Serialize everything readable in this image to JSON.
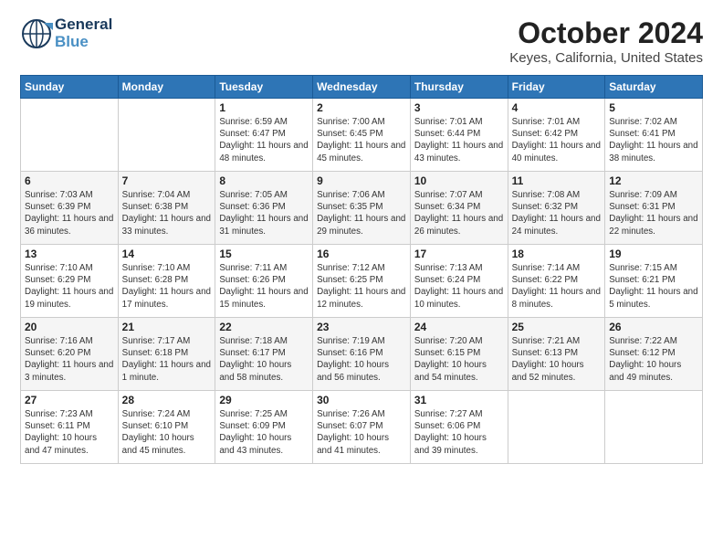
{
  "header": {
    "logo_general": "General",
    "logo_blue": "Blue",
    "title": "October 2024",
    "subtitle": "Keyes, California, United States"
  },
  "days_of_week": [
    "Sunday",
    "Monday",
    "Tuesday",
    "Wednesday",
    "Thursday",
    "Friday",
    "Saturday"
  ],
  "weeks": [
    [
      {
        "day": "",
        "info": ""
      },
      {
        "day": "",
        "info": ""
      },
      {
        "day": "1",
        "info": "Sunrise: 6:59 AM\nSunset: 6:47 PM\nDaylight: 11 hours and 48 minutes."
      },
      {
        "day": "2",
        "info": "Sunrise: 7:00 AM\nSunset: 6:45 PM\nDaylight: 11 hours and 45 minutes."
      },
      {
        "day": "3",
        "info": "Sunrise: 7:01 AM\nSunset: 6:44 PM\nDaylight: 11 hours and 43 minutes."
      },
      {
        "day": "4",
        "info": "Sunrise: 7:01 AM\nSunset: 6:42 PM\nDaylight: 11 hours and 40 minutes."
      },
      {
        "day": "5",
        "info": "Sunrise: 7:02 AM\nSunset: 6:41 PM\nDaylight: 11 hours and 38 minutes."
      }
    ],
    [
      {
        "day": "6",
        "info": "Sunrise: 7:03 AM\nSunset: 6:39 PM\nDaylight: 11 hours and 36 minutes."
      },
      {
        "day": "7",
        "info": "Sunrise: 7:04 AM\nSunset: 6:38 PM\nDaylight: 11 hours and 33 minutes."
      },
      {
        "day": "8",
        "info": "Sunrise: 7:05 AM\nSunset: 6:36 PM\nDaylight: 11 hours and 31 minutes."
      },
      {
        "day": "9",
        "info": "Sunrise: 7:06 AM\nSunset: 6:35 PM\nDaylight: 11 hours and 29 minutes."
      },
      {
        "day": "10",
        "info": "Sunrise: 7:07 AM\nSunset: 6:34 PM\nDaylight: 11 hours and 26 minutes."
      },
      {
        "day": "11",
        "info": "Sunrise: 7:08 AM\nSunset: 6:32 PM\nDaylight: 11 hours and 24 minutes."
      },
      {
        "day": "12",
        "info": "Sunrise: 7:09 AM\nSunset: 6:31 PM\nDaylight: 11 hours and 22 minutes."
      }
    ],
    [
      {
        "day": "13",
        "info": "Sunrise: 7:10 AM\nSunset: 6:29 PM\nDaylight: 11 hours and 19 minutes."
      },
      {
        "day": "14",
        "info": "Sunrise: 7:10 AM\nSunset: 6:28 PM\nDaylight: 11 hours and 17 minutes."
      },
      {
        "day": "15",
        "info": "Sunrise: 7:11 AM\nSunset: 6:26 PM\nDaylight: 11 hours and 15 minutes."
      },
      {
        "day": "16",
        "info": "Sunrise: 7:12 AM\nSunset: 6:25 PM\nDaylight: 11 hours and 12 minutes."
      },
      {
        "day": "17",
        "info": "Sunrise: 7:13 AM\nSunset: 6:24 PM\nDaylight: 11 hours and 10 minutes."
      },
      {
        "day": "18",
        "info": "Sunrise: 7:14 AM\nSunset: 6:22 PM\nDaylight: 11 hours and 8 minutes."
      },
      {
        "day": "19",
        "info": "Sunrise: 7:15 AM\nSunset: 6:21 PM\nDaylight: 11 hours and 5 minutes."
      }
    ],
    [
      {
        "day": "20",
        "info": "Sunrise: 7:16 AM\nSunset: 6:20 PM\nDaylight: 11 hours and 3 minutes."
      },
      {
        "day": "21",
        "info": "Sunrise: 7:17 AM\nSunset: 6:18 PM\nDaylight: 11 hours and 1 minute."
      },
      {
        "day": "22",
        "info": "Sunrise: 7:18 AM\nSunset: 6:17 PM\nDaylight: 10 hours and 58 minutes."
      },
      {
        "day": "23",
        "info": "Sunrise: 7:19 AM\nSunset: 6:16 PM\nDaylight: 10 hours and 56 minutes."
      },
      {
        "day": "24",
        "info": "Sunrise: 7:20 AM\nSunset: 6:15 PM\nDaylight: 10 hours and 54 minutes."
      },
      {
        "day": "25",
        "info": "Sunrise: 7:21 AM\nSunset: 6:13 PM\nDaylight: 10 hours and 52 minutes."
      },
      {
        "day": "26",
        "info": "Sunrise: 7:22 AM\nSunset: 6:12 PM\nDaylight: 10 hours and 49 minutes."
      }
    ],
    [
      {
        "day": "27",
        "info": "Sunrise: 7:23 AM\nSunset: 6:11 PM\nDaylight: 10 hours and 47 minutes."
      },
      {
        "day": "28",
        "info": "Sunrise: 7:24 AM\nSunset: 6:10 PM\nDaylight: 10 hours and 45 minutes."
      },
      {
        "day": "29",
        "info": "Sunrise: 7:25 AM\nSunset: 6:09 PM\nDaylight: 10 hours and 43 minutes."
      },
      {
        "day": "30",
        "info": "Sunrise: 7:26 AM\nSunset: 6:07 PM\nDaylight: 10 hours and 41 minutes."
      },
      {
        "day": "31",
        "info": "Sunrise: 7:27 AM\nSunset: 6:06 PM\nDaylight: 10 hours and 39 minutes."
      },
      {
        "day": "",
        "info": ""
      },
      {
        "day": "",
        "info": ""
      }
    ]
  ]
}
